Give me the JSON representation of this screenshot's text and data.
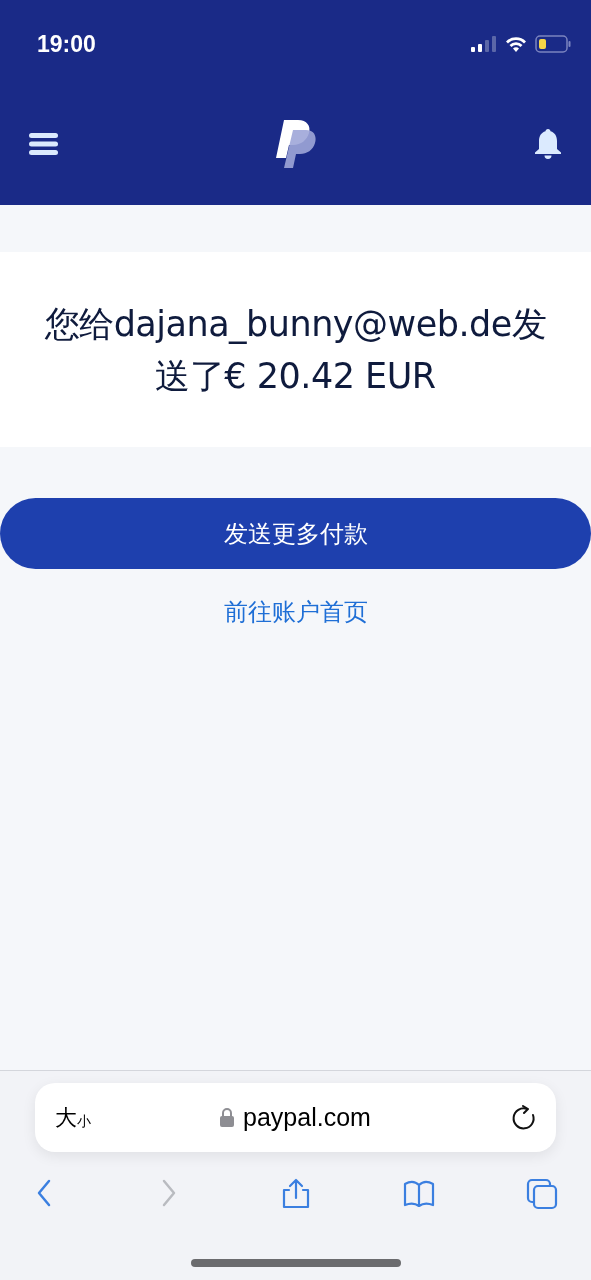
{
  "status_bar": {
    "time": "19:00"
  },
  "message": {
    "text": "您给dajana_bunny@web.de发送了€ 20.42 EUR"
  },
  "actions": {
    "primary_button": "发送更多付款",
    "link": "前往账户首页"
  },
  "browser": {
    "text_size_button": {
      "large": "大",
      "small": "小"
    },
    "url": "paypal.com",
    "toolbar": [
      {
        "kind": "back",
        "disabled": false
      },
      {
        "kind": "forward",
        "disabled": true
      },
      {
        "kind": "share",
        "disabled": false
      },
      {
        "kind": "bookmarks",
        "disabled": false
      },
      {
        "kind": "tabs",
        "disabled": false
      }
    ]
  }
}
